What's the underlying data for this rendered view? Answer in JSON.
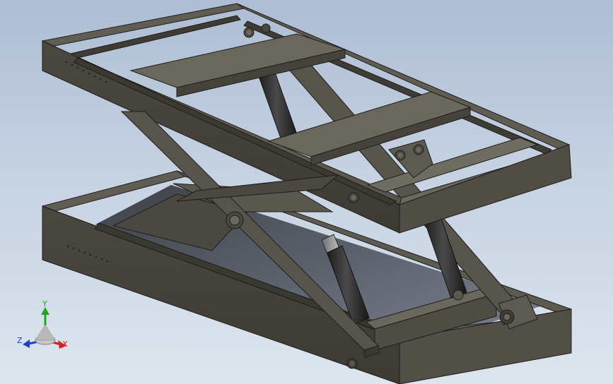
{
  "viewport": {
    "background_top": "#aebdd4",
    "background_bottom": "#dde5ee",
    "model_color": "#4f4d44"
  },
  "triad": {
    "x_label": "X",
    "y_label": "Y",
    "z_label": "Z",
    "x_color": "#d42020",
    "y_color": "#1fa51f",
    "z_color": "#1f3fd4"
  }
}
